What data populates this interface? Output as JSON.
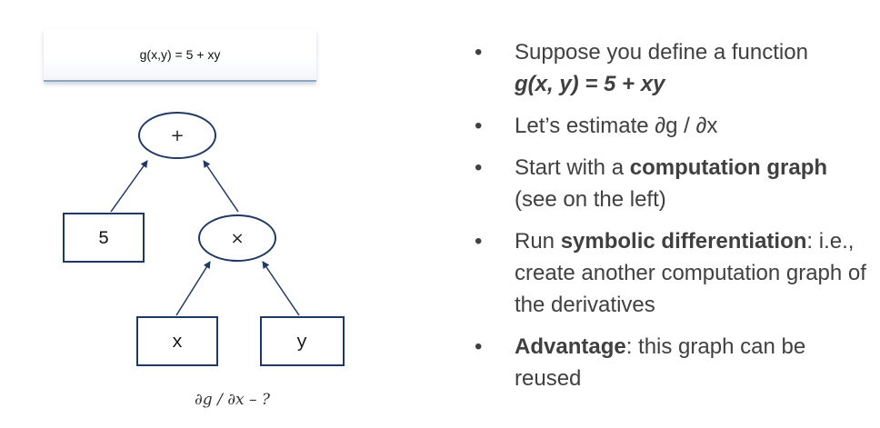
{
  "formula_box": {
    "text": "g(x,y) = 5 + xy"
  },
  "graph": {
    "nodes": [
      {
        "id": "plus",
        "label": "+"
      },
      {
        "id": "const5",
        "label": "5"
      },
      {
        "id": "times",
        "label": "×"
      },
      {
        "id": "x",
        "label": "x"
      },
      {
        "id": "y",
        "label": "y"
      }
    ],
    "edges": [
      {
        "from": "const5",
        "to": "plus"
      },
      {
        "from": "times",
        "to": "plus"
      },
      {
        "from": "x",
        "to": "times"
      },
      {
        "from": "y",
        "to": "times"
      }
    ],
    "caption": "∂g / ∂x – ?"
  },
  "bullets": [
    {
      "pre": "Suppose you define a function ",
      "bold": "",
      "post": "",
      "math": "g(x, y) = 5 + xy"
    },
    {
      "pre": "Let’s estimate ∂g / ∂x",
      "bold": "",
      "post": "",
      "math": ""
    },
    {
      "pre": "Start with a ",
      "bold": "computation graph",
      "post": " (see on the left)",
      "math": ""
    },
    {
      "pre": "Run ",
      "bold": "symbolic differentiation",
      "post": ": i.e., create another computation graph of the derivatives",
      "math": ""
    },
    {
      "pre": "",
      "bold": "Advantage",
      "post": ": this graph can be reused",
      "math": ""
    }
  ]
}
